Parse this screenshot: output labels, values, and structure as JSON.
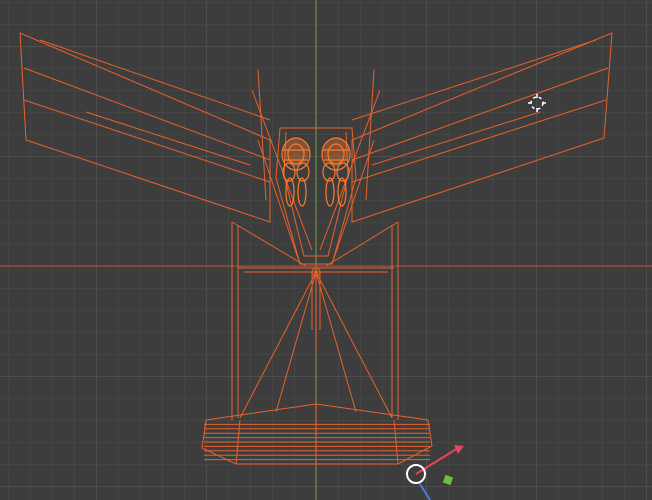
{
  "viewport": {
    "background_color": "#3d3d3d",
    "grid_minor_color": "#454545",
    "grid_major_color": "#4e4e4e",
    "y_axis_color": "#6e9a3a",
    "x_axis_color": "#b34a3a",
    "wireframe_color": "#e8622a",
    "wireframe_highlight_color": "#ff7a2a",
    "cursor_color": "#ffffff",
    "gizmo_x_color": "#e8455a",
    "gizmo_y_color": "#6ac43a",
    "gizmo_z_color": "#4a7ad8"
  },
  "scene": {
    "selected_object": "aircraft-wireframe",
    "icons": {
      "cursor": "3d-cursor-icon",
      "origin": "object-origin-icon",
      "gizmo": "transform-gizmo-icon"
    }
  }
}
